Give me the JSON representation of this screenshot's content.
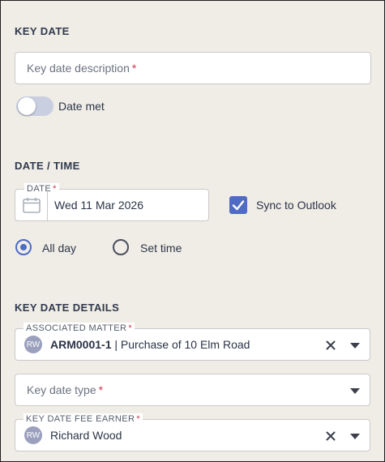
{
  "key_date": {
    "section_title": "KEY DATE",
    "description_placeholder": "Key date description",
    "required_mark": "*",
    "date_met_label": "Date met",
    "date_met_on": false
  },
  "date_time": {
    "section_title": "DATE / TIME",
    "date_label": "DATE",
    "date_value": "Wed 11 Mar 2026",
    "sync_label": "Sync to Outlook",
    "sync_checked": true,
    "all_day_label": "All day",
    "set_time_label": "Set time",
    "selected": "All day"
  },
  "details": {
    "section_title": "KEY DATE DETAILS",
    "matter_label": "ASSOCIATED MATTER",
    "matter_avatar": "RW",
    "matter_code": "ARM0001-1",
    "matter_separator": " | ",
    "matter_name": "Purchase of 10 Elm Road",
    "type_placeholder": "Key date type",
    "fee_earner_label": "KEY DATE FEE EARNER",
    "fee_earner_avatar": "RW",
    "fee_earner_name": "Richard Wood"
  },
  "colors": {
    "background": "#f0ede6",
    "accent": "#4f6bc4",
    "required": "#d6334a",
    "avatar": "#9aa0bd"
  },
  "icons": [
    "calendar-icon",
    "check-icon",
    "clear-icon",
    "chevron-down-icon"
  ]
}
